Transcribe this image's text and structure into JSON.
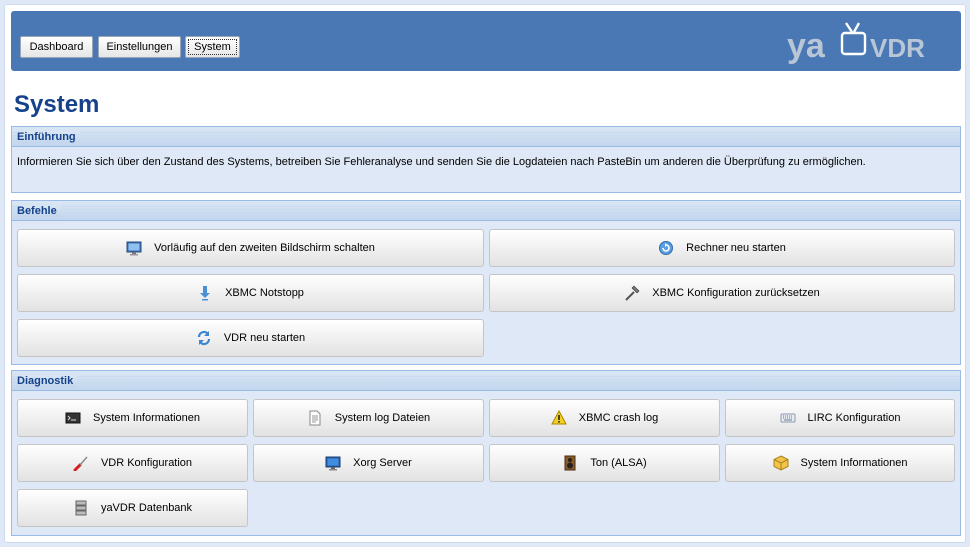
{
  "nav": {
    "tabs": [
      {
        "label": "Dashboard"
      },
      {
        "label": "Einstellungen"
      },
      {
        "label": "System",
        "active": true
      }
    ]
  },
  "logo": {
    "text_left": "ya",
    "text_right": "VDR"
  },
  "page_title": "System",
  "intro": {
    "title": "Einführung",
    "text": "Informieren Sie sich über den Zustand des Systems, betreiben Sie Fehleranalyse und senden Sie die Logdateien nach PasteBin um anderen die Überprüfung zu ermöglichen."
  },
  "commands": {
    "title": "Befehle",
    "buttons": [
      {
        "label": "Vorläufig auf den zweiten Bildschirm schalten",
        "icon": "monitor-icon"
      },
      {
        "label": "Rechner neu starten",
        "icon": "restart-icon"
      },
      {
        "label": "XBMC Notstopp",
        "icon": "emergency-stop-icon"
      },
      {
        "label": "XBMC Konfiguration zurücksetzen",
        "icon": "hammer-icon"
      },
      {
        "label": "VDR neu starten",
        "icon": "refresh-icon"
      }
    ]
  },
  "diagnostics": {
    "title": "Diagnostik",
    "buttons": [
      {
        "label": "System Informationen",
        "icon": "terminal-icon"
      },
      {
        "label": "System log Dateien",
        "icon": "document-icon"
      },
      {
        "label": "XBMC crash log",
        "icon": "warning-icon"
      },
      {
        "label": "LIRC Konfiguration",
        "icon": "keyboard-icon"
      },
      {
        "label": "VDR Konfiguration",
        "icon": "screwdriver-icon"
      },
      {
        "label": "Xorg Server",
        "icon": "display-icon"
      },
      {
        "label": "Ton (ALSA)",
        "icon": "speaker-icon"
      },
      {
        "label": "System Informationen",
        "icon": "package-icon"
      },
      {
        "label": "yaVDR Datenbank",
        "icon": "database-icon"
      }
    ]
  },
  "colors": {
    "header_bg": "#4a78b4",
    "title": "#15428b",
    "panel_bg": "#dfe8f6",
    "panel_border": "#99bbe8"
  }
}
